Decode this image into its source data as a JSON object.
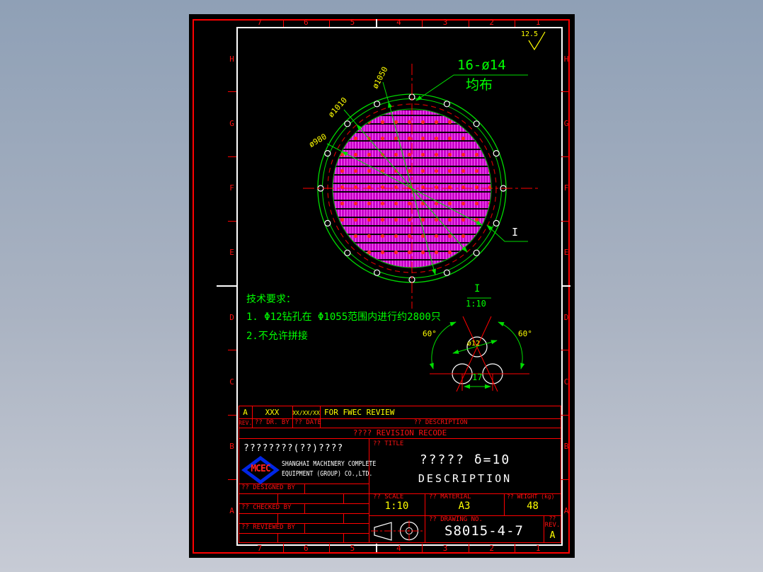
{
  "frame": {
    "column_labels": [
      "7",
      "6",
      "5",
      "4",
      "3",
      "2",
      "1"
    ],
    "row_labels": [
      "H",
      "G",
      "F",
      "E",
      "D",
      "C",
      "B",
      "A"
    ]
  },
  "drawing": {
    "surface_finish": "12.5",
    "hole_callout": "16-ø14",
    "hole_callout_note": "均布",
    "dim_outer": "ø1050",
    "dim_bolt": "ø1010",
    "dim_hatch": "ø980",
    "section_mark": "I",
    "tech_title": "技术要求：",
    "tech_item_1": "1. Φ12钻孔在 Φ1055范围内进行约2800只",
    "tech_item_2": "2.不允许拼接",
    "detail": {
      "label": "I",
      "scale": "1:10",
      "angle_left": "60°",
      "angle_right": "60°",
      "hole_dia": "ø12",
      "pitch": "17"
    }
  },
  "revision_table": {
    "row": {
      "rev": "A",
      "by": "XXX",
      "date": "XX/XX/XX",
      "description": "FOR FWEC REVIEW"
    },
    "headers": {
      "rev": "REV.",
      "by": "?? DR. BY",
      "date": "?? DATE",
      "description": "?? DESCRIPTION"
    },
    "banner": "???? REVISION RECODE"
  },
  "title_block": {
    "company_cn": "????????(??)????",
    "logo": "MCEC",
    "company_en_line1": "SHANGHAI MACHINERY COMPLETE",
    "company_en_line2": "EQUIPMENT (GROUP) CO.,LTD.",
    "title_label": "?? TITLE",
    "title_main": "????? δ=10",
    "title_sub": "DESCRIPTION",
    "designed_by": "?? DESIGNED BY",
    "checked_by": "?? CHECKED BY",
    "reviewed_by": "?? REVIEWED BY",
    "scale_label": "?? SCALE",
    "scale_value": "1:10",
    "material_label": "?? MATERIAL",
    "material_value": "A3",
    "weight_label": "?? WEIGHT (kg)",
    "weight_value": "48",
    "drawing_no_label": "?? DRAWING NO.",
    "drawing_no": "S8015-4-7",
    "rev_q": "??",
    "rev_label": "REV.",
    "rev_value": "A"
  },
  "colors": {
    "red": "#ff0000",
    "green": "#00ff00",
    "yellow": "#ffff00",
    "magenta": "#ff00ff",
    "white": "#ffffff",
    "logo_blue": "#0026e6",
    "black": "#000000"
  }
}
